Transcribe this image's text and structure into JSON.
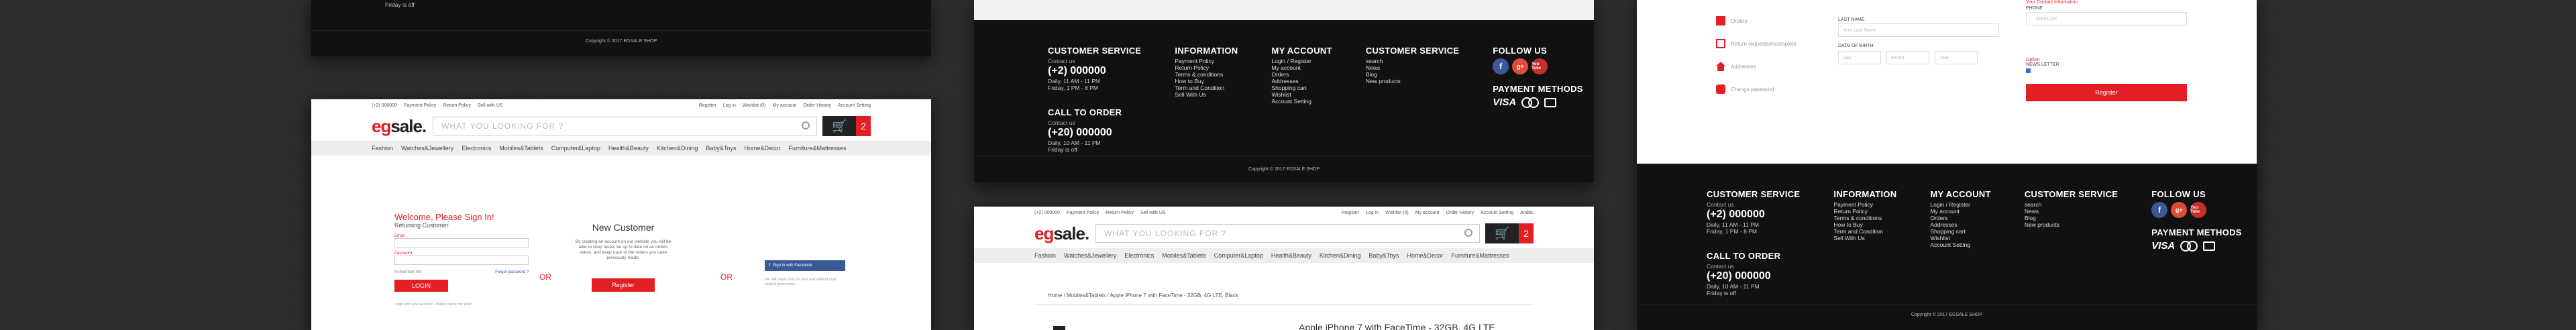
{
  "footer": {
    "customer_service": {
      "title": "CUSTOMER SERVICE",
      "contact": "Contact us",
      "phone": "(+2) 000000",
      "hours1": "Daily, 11 AM - 11 PM",
      "hours2": "Friday, 1 PM - 8 PM"
    },
    "call_to_order": {
      "title": "CALL TO ORDER",
      "contact": "Contact us",
      "phone": "(+20) 000000",
      "hours1": "Daily, 10 AM - 11 PM",
      "hours2": "Friday is off"
    },
    "information": {
      "title": "INFORMATION",
      "links": [
        "Payment Policy",
        "Return Policy",
        "Terms & conditions",
        "How to Buy",
        "Term and Condition",
        "Sell With Us"
      ]
    },
    "my_account": {
      "title": "MY ACCOUNT",
      "links": [
        "Login / Register",
        "My account",
        "Orders",
        "Addresses",
        "Shopping cart",
        "Wishlist",
        "Account Setting"
      ]
    },
    "customer_service_links": {
      "title": "CUSTOMER SERVICE",
      "links": [
        "search",
        "News",
        "Blog",
        "New products"
      ]
    },
    "follow_us": {
      "title": "FOLLOW US",
      "icons": [
        "f",
        "g+",
        "You Tube"
      ]
    },
    "payment": {
      "title": "PAYMENT METHODS",
      "visa": "VISA"
    },
    "copyright": "Copyright © 2017 EGSALE SHOP",
    "partial_small": [
      "Friday is off"
    ]
  },
  "store": {
    "topbar_left": [
      "(+2) 000000",
      "Payment Policy",
      "Return Policy",
      "Sell with US"
    ],
    "topbar_right": [
      "Register",
      "Log in",
      "Wishlist (0)",
      "My account",
      "Order History",
      "Account Setting",
      "Arabic"
    ],
    "logo_prefix": "eg",
    "logo_suffix": "sale.",
    "search_placeholder": "WHAT YOU LOOKING FOR ?",
    "cart_count": "2",
    "categories": [
      "Fashion",
      "Watches&Jewellery",
      "Electronics",
      "Mobiles&Tablets",
      "Computer&Laptop",
      "Health&Beauty",
      "Kitchen&Dining",
      "Baby&Toys",
      "Home&Decor",
      "Furniture&Mattresses"
    ]
  },
  "login": {
    "title": "Welcome, Please Sign In!",
    "returning": "Returning Customer",
    "email_label": "Email",
    "password_label": "Password",
    "remember": "Remember Me",
    "forgot": "Forgot password ?",
    "login_btn": "LOGIN",
    "note": "Login into your account. Please check the error",
    "or": "OR",
    "new_customer": "New Customer",
    "new_text": "By creating an account on our website you will be able to shop faster, be up to date on an orders status, and keep track of the orders you have previously made.",
    "register_btn": "Register",
    "facebook_btn": "Sign in with Facebook",
    "fb_note": "We will never post on your wall without your explicit permission."
  },
  "product": {
    "breadcrumb": "Home / Mobiles&Tablets / Apple iPhone 7 with FaceTime - 32GB, 4G LTE, Black",
    "title": "Apple iPhone 7 with FaceTime - 32GB, 4G LTE"
  },
  "register": {
    "sidebar": [
      "Orders",
      "Return requests/incomplete",
      "Addresses",
      "Change password"
    ],
    "last_name": "LAST NAME",
    "last_name_ph": "Your Last Name",
    "dob": "DATE OF BIRTH",
    "dob_day": "Day",
    "dob_month": "Month",
    "dob_year": "Year",
    "your_contact": "Your Contact Information",
    "phone": "PHONE",
    "phone_ph": "01001234",
    "options": "Option",
    "newsletter": "NEWS LETTER",
    "register_btn": "Register"
  }
}
